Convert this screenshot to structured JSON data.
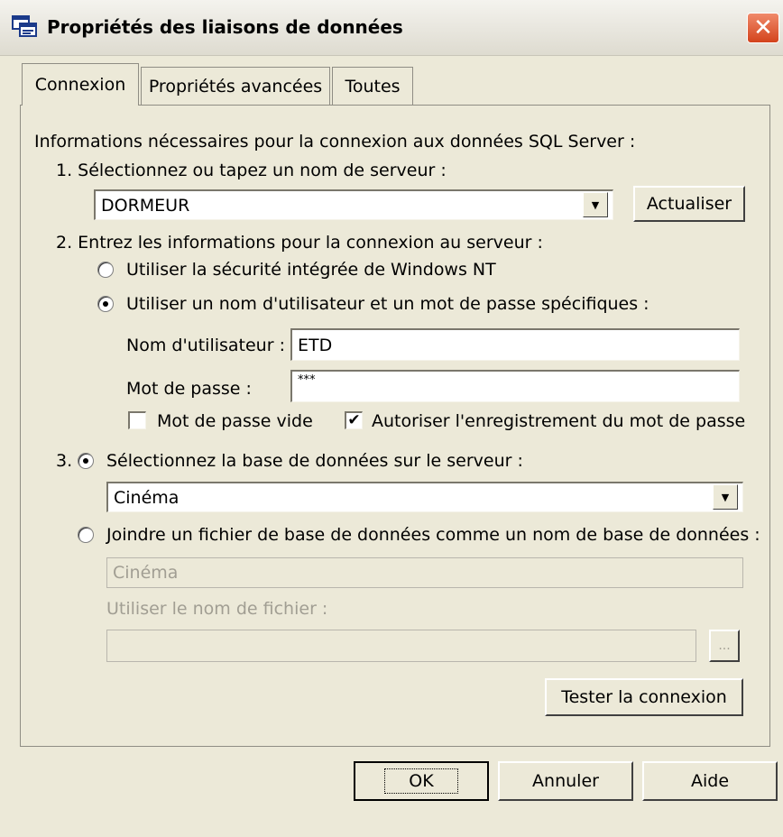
{
  "window": {
    "title": "Propriétés des liaisons de données",
    "close_label": "✕"
  },
  "tabs": [
    {
      "label": "Connexion",
      "selected": true
    },
    {
      "label": "Propriétés avancées",
      "selected": false
    },
    {
      "label": "Toutes",
      "selected": false
    }
  ],
  "intro": "Informations nécessaires pour la connexion aux données SQL Server :",
  "step1": {
    "label": "1. Sélectionnez ou tapez un nom de serveur :",
    "server_value": "DORMEUR",
    "refresh_button": "Actualiser"
  },
  "step2": {
    "label": "2. Entrez les informations pour la connexion au serveur :",
    "radio_integrated": "Utiliser la sécurité intégrée de Windows NT",
    "radio_specific": "Utiliser un nom d'utilisateur et un mot de passe spécifiques :",
    "selected_auth": "specific",
    "username_label": "Nom d'utilisateur :",
    "username_value": "ETD",
    "password_label": "Mot de passe :",
    "password_value": "***",
    "blank_password_label": "Mot de passe vide",
    "blank_password_checked": false,
    "save_password_label": "Autoriser l'enregistrement du mot de passe",
    "save_password_checked": true
  },
  "step3": {
    "number": "3.",
    "radio_select_db": "Sélectionnez la base de données sur le serveur :",
    "database_value": "Cinéma",
    "radio_attach_file": "Joindre un fichier de base de données comme un nom de base de données :",
    "attach_db_name": "Cinéma",
    "filename_label": "Utiliser le nom de fichier :",
    "filename_value": "",
    "browse_label": "...",
    "test_button": "Tester la connexion"
  },
  "footer": {
    "ok": "OK",
    "cancel": "Annuler",
    "help": "Aide"
  },
  "colors": {
    "dialog_bg": "#ece9d8",
    "close_red": "#d3431c",
    "field_border": "#7f9db9"
  }
}
